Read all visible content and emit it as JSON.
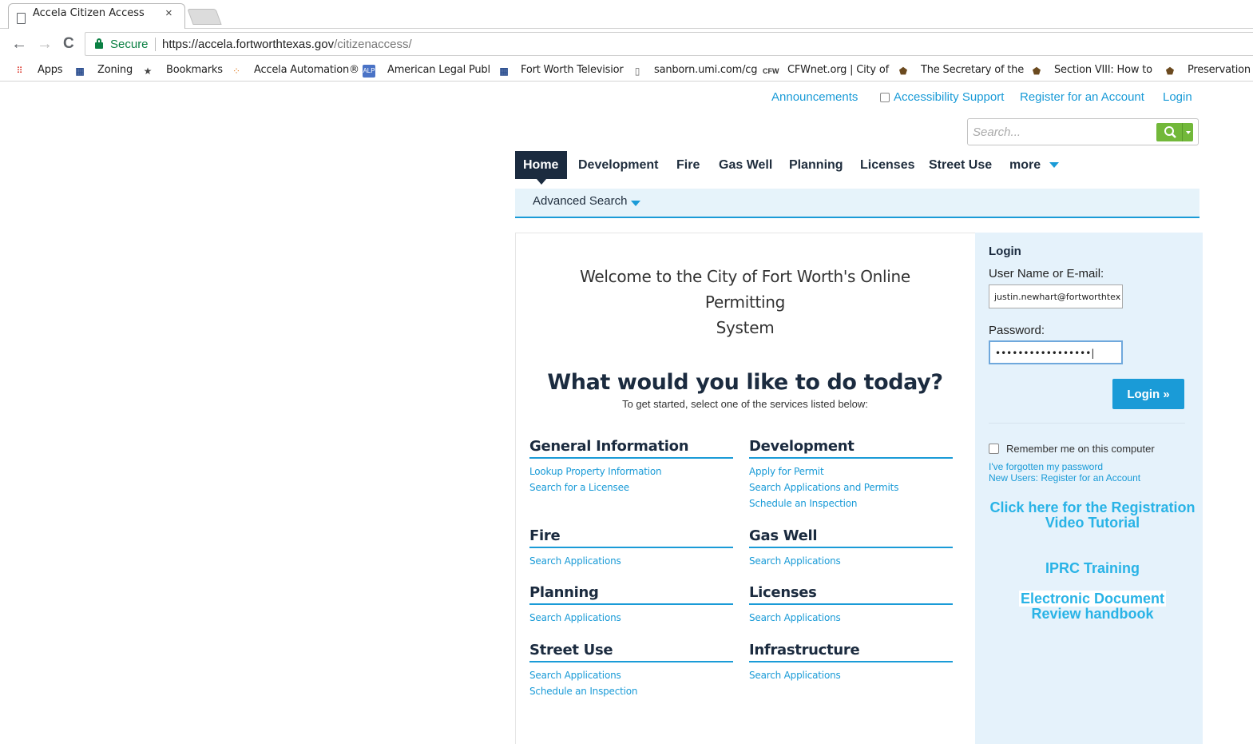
{
  "browser": {
    "tab_title": "Accela Citizen Access",
    "tab_close": "×",
    "back": "←",
    "forward": "→",
    "reload": "C",
    "secure_label": "Secure",
    "url_host": "https://accela.fortworthtexas.gov",
    "url_path": "/citizenaccess/",
    "bookmarks": [
      {
        "label": "Apps",
        "icon": "apps-grid-icon"
      },
      {
        "label": "Zoning",
        "icon": "fw-logo-icon"
      },
      {
        "label": "Bookmarks",
        "icon": "star-icon"
      },
      {
        "label": "Accela Automation®",
        "icon": "accela-icon"
      },
      {
        "label": "American Legal Publ",
        "icon": "alp-icon"
      },
      {
        "label": "Fort Worth Televisior",
        "icon": "fw-logo-icon"
      },
      {
        "label": "sanborn.umi.com/cg",
        "icon": "page-icon"
      },
      {
        "label": "CFWnet.org | City of",
        "icon": "cfw-icon"
      },
      {
        "label": "The Secretary of the",
        "icon": "nps-icon"
      },
      {
        "label": "Section VIII: How to",
        "icon": "nps-icon"
      },
      {
        "label": "Preservation",
        "icon": "nps-icon"
      }
    ]
  },
  "util_links": {
    "announcements": "Announcements",
    "accessibility": "Accessibility Support",
    "register": "Register for an Account",
    "login": "Login"
  },
  "search": {
    "placeholder": "Search..."
  },
  "nav": {
    "items": [
      "Home",
      "Development",
      "Fire",
      "Gas Well",
      "Planning",
      "Licenses",
      "Street Use",
      "more"
    ],
    "active": "Home",
    "advanced_search": "Advanced Search"
  },
  "main": {
    "welcome_line1": "Welcome to the City of Fort Worth's Online Permitting",
    "welcome_line2": "System",
    "headline": "What would you like to do today?",
    "subheadline": "To get started, select one of the services listed below:",
    "services": [
      {
        "title": "General Information",
        "links": [
          "Lookup Property Information",
          "Search for a Licensee"
        ]
      },
      {
        "title": "Development",
        "links": [
          "Apply for Permit",
          "Search Applications and Permits",
          "Schedule an Inspection"
        ]
      },
      {
        "title": "Fire",
        "links": [
          "Search Applications"
        ]
      },
      {
        "title": "Gas Well",
        "links": [
          "Search Applications"
        ]
      },
      {
        "title": "Planning",
        "links": [
          "Search Applications"
        ]
      },
      {
        "title": "Licenses",
        "links": [
          "Search Applications"
        ]
      },
      {
        "title": "Street Use",
        "links": [
          "Search Applications",
          "Schedule an Inspection"
        ]
      },
      {
        "title": "Infrastructure",
        "links": [
          "Search Applications"
        ]
      }
    ]
  },
  "login": {
    "heading": "Login",
    "username_label": "User Name or E-mail:",
    "username_value": "justin.newhart@fortworthtex",
    "password_label": "Password:",
    "password_value": "•••••••••••••••••|",
    "button": "Login »",
    "remember": "Remember me on this computer",
    "forgot": "I've forgotten my password",
    "new_users": "New Users: Register for an Account",
    "promo_registration_1": "Click here for the Registration",
    "promo_registration_2": "Video Tutorial",
    "promo_iprc": "IPRC Training",
    "promo_edr_1": "Electronic Document",
    "promo_edr_2": "Review handbook"
  },
  "colors": {
    "accent": "#1a9bd7",
    "navy": "#1b2b3f",
    "search_green": "#72b83a",
    "side_panel": "#e5f2fb"
  }
}
